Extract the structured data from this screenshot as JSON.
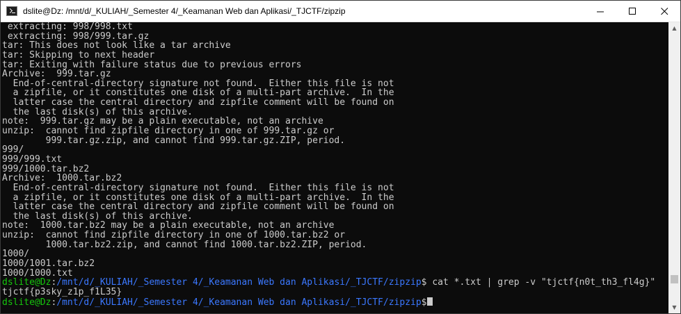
{
  "window": {
    "title": "dslite@Dz: /mnt/d/_KULIAH/_Semester 4/_Keamanan Web dan Aplikasi/_TJCTF/zipzip",
    "controls": [
      "minimize-icon",
      "maximize-icon",
      "close-icon"
    ]
  },
  "terminal": {
    "lines": [
      " extracting: 998/998.txt",
      " extracting: 998/999.tar.gz",
      "tar: This does not look like a tar archive",
      "tar: Skipping to next header",
      "tar: Exiting with failure status due to previous errors",
      "Archive:  999.tar.gz",
      "  End-of-central-directory signature not found.  Either this file is not",
      "  a zipfile, or it constitutes one disk of a multi-part archive.  In the",
      "  latter case the central directory and zipfile comment will be found on",
      "  the last disk(s) of this archive.",
      "note:  999.tar.gz may be a plain executable, not an archive",
      "unzip:  cannot find zipfile directory in one of 999.tar.gz or",
      "        999.tar.gz.zip, and cannot find 999.tar.gz.ZIP, period.",
      "999/",
      "999/999.txt",
      "999/1000.tar.bz2",
      "Archive:  1000.tar.bz2",
      "  End-of-central-directory signature not found.  Either this file is not",
      "  a zipfile, or it constitutes one disk of a multi-part archive.  In the",
      "  latter case the central directory and zipfile comment will be found on",
      "  the last disk(s) of this archive.",
      "note:  1000.tar.bz2 may be a plain executable, not an archive",
      "unzip:  cannot find zipfile directory in one of 1000.tar.bz2 or",
      "        1000.tar.bz2.zip, and cannot find 1000.tar.bz2.ZIP, period.",
      "1000/",
      "1000/1001.tar.bz2",
      "1000/1000.txt"
    ],
    "prompt": {
      "user": "dslite@Dz",
      "separator": ":",
      "path": "/mnt/d/_KULIAH/_Semester 4/_Keamanan Web dan Aplikasi/_TJCTF/zipzip",
      "symbol": "$"
    },
    "command": " cat *.txt | grep -v \"tjctf{n0t_th3_fl4g}\"",
    "output": "tjctf{p3sky_z1p_f1L35}",
    "scrollbar": {
      "position": 0.93,
      "visible_fraction": 0.03
    }
  },
  "colors": {
    "background": "#0c0c0c",
    "text": "#cccccc",
    "prompt_user": "#16c60c",
    "prompt_path": "#3b78ff"
  }
}
